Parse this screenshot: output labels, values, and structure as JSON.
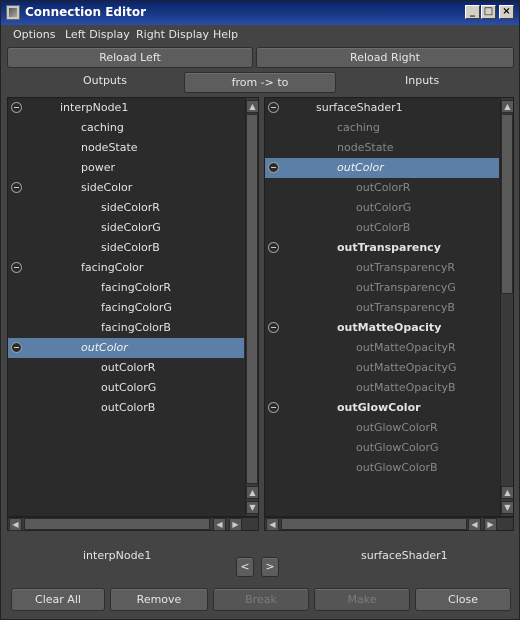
{
  "window": {
    "title": "Connection Editor"
  },
  "menu": [
    "Options",
    "Left Display",
    "Right Display",
    "Help"
  ],
  "reload_left": "Reload Left",
  "reload_right": "Reload Right",
  "outputs_label": "Outputs",
  "direction_button": "from -> to",
  "inputs_label": "Inputs",
  "left_tree": [
    {
      "label": "interpNode1",
      "level": 0,
      "expandable": true
    },
    {
      "label": "caching",
      "level": 1
    },
    {
      "label": "nodeState",
      "level": 1
    },
    {
      "label": "power",
      "level": 1
    },
    {
      "label": "sideColor",
      "level": 1,
      "expandable": true
    },
    {
      "label": "sideColorR",
      "level": 2
    },
    {
      "label": "sideColorG",
      "level": 2
    },
    {
      "label": "sideColorB",
      "level": 2
    },
    {
      "label": "facingColor",
      "level": 1,
      "expandable": true
    },
    {
      "label": "facingColorR",
      "level": 2
    },
    {
      "label": "facingColorG",
      "level": 2
    },
    {
      "label": "facingColorB",
      "level": 2
    },
    {
      "label": "outColor",
      "level": 1,
      "expandable": true,
      "selected": true,
      "italic": true
    },
    {
      "label": "outColorR",
      "level": 2
    },
    {
      "label": "outColorG",
      "level": 2
    },
    {
      "label": "outColorB",
      "level": 2
    }
  ],
  "right_tree": [
    {
      "label": "surfaceShader1",
      "level": 0,
      "expandable": true
    },
    {
      "label": "caching",
      "level": 1,
      "dim": true
    },
    {
      "label": "nodeState",
      "level": 1,
      "dim": true
    },
    {
      "label": "outColor",
      "level": 1,
      "expandable": true,
      "selected": true,
      "italic": true
    },
    {
      "label": "outColorR",
      "level": 2,
      "dim": true
    },
    {
      "label": "outColorG",
      "level": 2,
      "dim": true
    },
    {
      "label": "outColorB",
      "level": 2,
      "dim": true
    },
    {
      "label": "outTransparency",
      "level": 1,
      "expandable": true,
      "bold": true
    },
    {
      "label": "outTransparencyR",
      "level": 2,
      "dim": true
    },
    {
      "label": "outTransparencyG",
      "level": 2,
      "dim": true
    },
    {
      "label": "outTransparencyB",
      "level": 2,
      "dim": true
    },
    {
      "label": "outMatteOpacity",
      "level": 1,
      "expandable": true,
      "bold": true
    },
    {
      "label": "outMatteOpacityR",
      "level": 2,
      "dim": true
    },
    {
      "label": "outMatteOpacityG",
      "level": 2,
      "dim": true
    },
    {
      "label": "outMatteOpacityB",
      "level": 2,
      "dim": true
    },
    {
      "label": "outGlowColor",
      "level": 1,
      "expandable": true,
      "bold": true
    },
    {
      "label": "outGlowColorR",
      "level": 2,
      "dim": true
    },
    {
      "label": "outGlowColorG",
      "level": 2,
      "dim": true
    },
    {
      "label": "outGlowColorB",
      "level": 2,
      "dim": true
    }
  ],
  "left_node_name": "interpNode1",
  "right_node_name": "surfaceShader1",
  "nav_prev": "<",
  "nav_next": ">",
  "buttons": {
    "clear_all": "Clear All",
    "remove": "Remove",
    "break": "Break",
    "make": "Make",
    "close": "Close"
  },
  "colors": {
    "selection": "#5b7fa6",
    "panel_bg": "#2b2b2b",
    "window_bg": "#444444",
    "title_bar": "#0a246a"
  }
}
